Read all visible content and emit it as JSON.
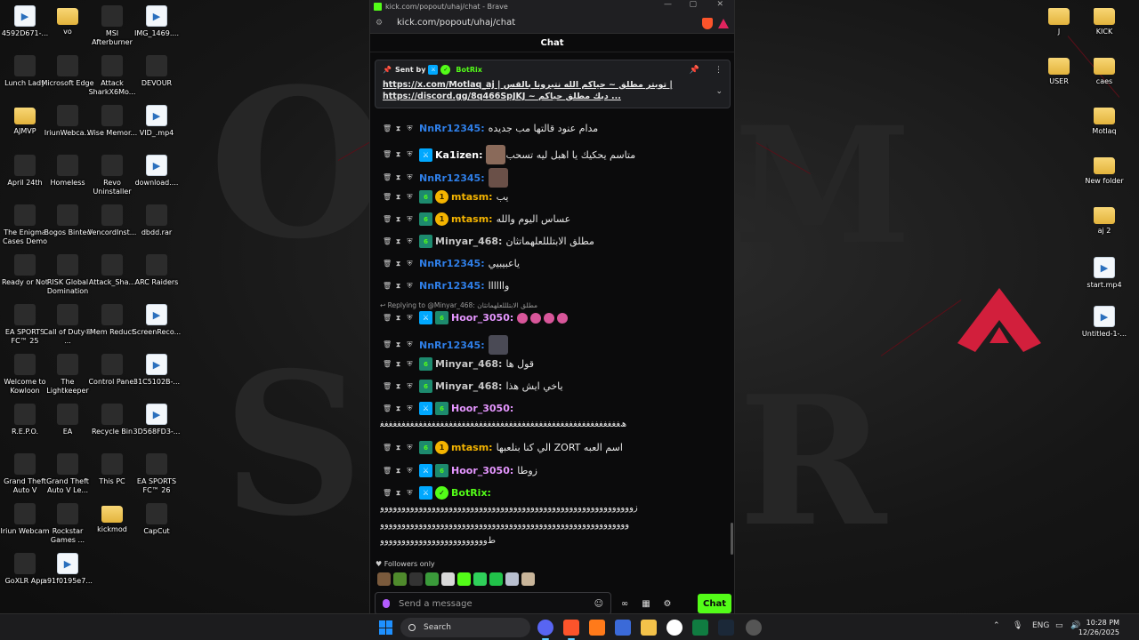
{
  "browser": {
    "title": "kick.com/popout/uhaj/chat - Brave",
    "url": "kick.com/popout/uhaj/chat",
    "minimize": "—",
    "maximize": "▢",
    "close": "✕"
  },
  "chat": {
    "header": "Chat",
    "pinned": {
      "sent_by": "Sent by",
      "sender": "BotRix",
      "line1": "https://x.com/Motlaq_aj | تويتر مطلق ~ حياكم الله نتبرونا بالقس |",
      "line2": "https://discord.gg/8q466SpJKJ ~ ديك مطلق حياكم ..."
    },
    "messages": [
      {
        "user": "NnRr12345:",
        "text": "مدام عنود قالتها مب جديده",
        "color": "#2f7fe8"
      },
      {
        "user": "Ka1izen:",
        "text": "متاسم يحكيك يا اهبل ليه تسحب",
        "color": "#ffffff"
      },
      {
        "user": "NnRr12345:",
        "text": "",
        "color": "#2f7fe8"
      },
      {
        "user": "mtasm:",
        "text": "يب",
        "color": "#f4b400"
      },
      {
        "user": "mtasm:",
        "text": "عساس اليوم والله",
        "color": "#f4b400"
      },
      {
        "user": "Minyar_468:",
        "text": "مطلق الابتلللعلهماتثان",
        "color": "#c8c8c8"
      },
      {
        "user": "NnRr12345:",
        "text": "ياعبيبيي",
        "color": "#2f7fe8"
      },
      {
        "user": "NnRr12345:",
        "text": "واااااا",
        "color": "#2f7fe8"
      },
      {
        "user": "Hoor_3050:",
        "text": "",
        "color": "#e596ff"
      },
      {
        "user": "NnRr12345:",
        "text": "",
        "color": "#2f7fe8"
      },
      {
        "user": "Minyar_468:",
        "text": "قول ها",
        "color": "#c8c8c8"
      },
      {
        "user": "Minyar_468:",
        "text": "ياخي ايش هذا",
        "color": "#c8c8c8"
      },
      {
        "user": "Hoor_3050:",
        "text": "",
        "color": "#e596ff"
      },
      {
        "user": "mtasm:",
        "text": "الي كنا بنلعبها ZORT اسم العبه",
        "color": "#f4b400"
      },
      {
        "user": "Hoor_3050:",
        "text": "زوطا",
        "color": "#e596ff"
      },
      {
        "user": "BotRix:",
        "text": "",
        "color": "#53fc18"
      }
    ],
    "reply_label": "Replying to @Minyar_468: مطلق الابتلللعلهماتثان",
    "hoor_long": "ﮪﻐﻐﻐﻐﻐﻐﻐﻐﻐﻐﻐﻐﻐﻐﻐﻐﻐﻐﻐﻐﻐﻐﻐﻐﻐﻐﻐﻐﻐﻐﻐﻐﻐﻐﻐﻐﻐﻐﻐﻐﻐﻐﻐﻐﻐﻐﻐﻐﻐﻐﻐﻐﻐﻐﻐﻐ",
    "botrix_line1": "ﺯووووووووووووووووووووووووووووووووووووووووووووووووووووووووووو",
    "botrix_line2": "وووووووووووووووووووووووووووووووووووووووووووووووووووووووووو",
    "botrix_line3": "ﻁووووووووووووووووووووووووو",
    "followers_only": "Followers only",
    "input_placeholder": "Send a message",
    "chat_button": "Chat"
  },
  "desktop_icons": [
    {
      "label": "4592D671-...",
      "kind": "file"
    },
    {
      "label": "vo",
      "kind": "folder"
    },
    {
      "label": "MSI Afterburner",
      "kind": "app"
    },
    {
      "label": "IMG_1469....",
      "kind": "file"
    },
    {
      "label": "Lunch Lady",
      "kind": "app"
    },
    {
      "label": "Microsoft Edge",
      "kind": "app"
    },
    {
      "label": "Attack SharkX6Mo...",
      "kind": "app"
    },
    {
      "label": "DEVOUR",
      "kind": "app"
    },
    {
      "label": "AJMVP",
      "kind": "folder"
    },
    {
      "label": "IriunWebca...",
      "kind": "app"
    },
    {
      "label": "Wise Memor...",
      "kind": "app"
    },
    {
      "label": "VID_.mp4",
      "kind": "file"
    },
    {
      "label": "April 24th",
      "kind": "app"
    },
    {
      "label": "Homeless",
      "kind": "app"
    },
    {
      "label": "Revo Uninstaller",
      "kind": "app"
    },
    {
      "label": "download....",
      "kind": "file"
    },
    {
      "label": "The Enigma Cases Demo",
      "kind": "app"
    },
    {
      "label": "Bogos Binted",
      "kind": "app"
    },
    {
      "label": "VencordInst...",
      "kind": "app"
    },
    {
      "label": "dbdd.rar",
      "kind": "app"
    },
    {
      "label": "Ready or Not",
      "kind": "app"
    },
    {
      "label": "RISK Global Domination",
      "kind": "app"
    },
    {
      "label": "Attack_Sha...",
      "kind": "app"
    },
    {
      "label": "ARC Raiders",
      "kind": "app"
    },
    {
      "label": "EA SPORTS FC™ 25",
      "kind": "app"
    },
    {
      "label": "Call of Duty® ...",
      "kind": "app"
    },
    {
      "label": "Mem Reduct",
      "kind": "app"
    },
    {
      "label": "ScreenReco...",
      "kind": "file"
    },
    {
      "label": "Welcome to Kowloon",
      "kind": "app"
    },
    {
      "label": "The Lightkeeper",
      "kind": "app"
    },
    {
      "label": "Control Panel",
      "kind": "app"
    },
    {
      "label": "31C5102B-...",
      "kind": "file"
    },
    {
      "label": "R.E.P.O.",
      "kind": "app"
    },
    {
      "label": "EA",
      "kind": "app"
    },
    {
      "label": "Recycle Bin",
      "kind": "app"
    },
    {
      "label": "3D568FD3-...",
      "kind": "file"
    },
    {
      "label": "Grand Theft Auto V",
      "kind": "app"
    },
    {
      "label": "Grand Theft Auto V Le...",
      "kind": "app"
    },
    {
      "label": "This PC",
      "kind": "app"
    },
    {
      "label": "EA SPORTS FC™ 26",
      "kind": "app"
    },
    {
      "label": "Iriun Webcam",
      "kind": "app"
    },
    {
      "label": "Rockstar Games ...",
      "kind": "app"
    },
    {
      "label": "kickmod",
      "kind": "folder"
    },
    {
      "label": "CapCut",
      "kind": "app"
    },
    {
      "label": "GoXLR App",
      "kind": "app"
    },
    {
      "label": "a91f0195e7...",
      "kind": "file"
    }
  ],
  "right_icons": [
    {
      "label": "J",
      "kind": "folder"
    },
    {
      "label": "KICK",
      "kind": "folder"
    },
    {
      "label": "USER",
      "kind": "folder"
    },
    {
      "label": "caes",
      "kind": "folder"
    },
    {
      "label": "Motlaq",
      "kind": "folder"
    },
    {
      "label": "New folder",
      "kind": "folder"
    },
    {
      "label": "aj 2",
      "kind": "folder"
    },
    {
      "label": "start.mp4",
      "kind": "file"
    },
    {
      "label": "Untitled-1-...",
      "kind": "file"
    }
  ],
  "taskbar": {
    "search": "Search",
    "language": "ENG",
    "time": "10:28 PM",
    "date": "12/26/2025"
  },
  "colors": {
    "kick_green": "#53fc18",
    "mod_blue": "#00a8ff"
  }
}
